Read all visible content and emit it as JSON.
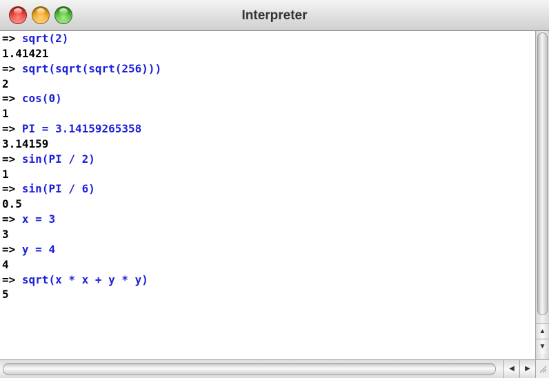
{
  "window": {
    "title": "Interpreter"
  },
  "console": {
    "prompt": "=>",
    "lines": [
      {
        "type": "input",
        "text": "sqrt(2)"
      },
      {
        "type": "output",
        "text": "1.41421"
      },
      {
        "type": "input",
        "text": "sqrt(sqrt(sqrt(256)))"
      },
      {
        "type": "output",
        "text": "2"
      },
      {
        "type": "input",
        "text": "cos(0)"
      },
      {
        "type": "output",
        "text": "1"
      },
      {
        "type": "input",
        "text": "PI = 3.14159265358"
      },
      {
        "type": "output",
        "text": "3.14159"
      },
      {
        "type": "input",
        "text": "sin(PI / 2)"
      },
      {
        "type": "output",
        "text": "1"
      },
      {
        "type": "input",
        "text": "sin(PI / 6)"
      },
      {
        "type": "output",
        "text": "0.5"
      },
      {
        "type": "input",
        "text": "x = 3"
      },
      {
        "type": "output",
        "text": "3"
      },
      {
        "type": "input",
        "text": "y = 4"
      },
      {
        "type": "output",
        "text": "4"
      },
      {
        "type": "input",
        "text": "sqrt(x * x + y * y)"
      },
      {
        "type": "output",
        "text": "5"
      }
    ]
  },
  "icons": {
    "close": "close-traffic-light-icon",
    "minimize": "minimize-traffic-light-icon",
    "zoom": "zoom-traffic-light-icon",
    "scroll_up": "arrow-up-icon",
    "scroll_down": "arrow-down-icon",
    "scroll_left": "arrow-left-icon",
    "scroll_right": "arrow-right-icon",
    "resize": "resize-grip-icon"
  },
  "colors": {
    "command": "#1c20d9",
    "output": "#000000",
    "background": "#ffffff"
  }
}
